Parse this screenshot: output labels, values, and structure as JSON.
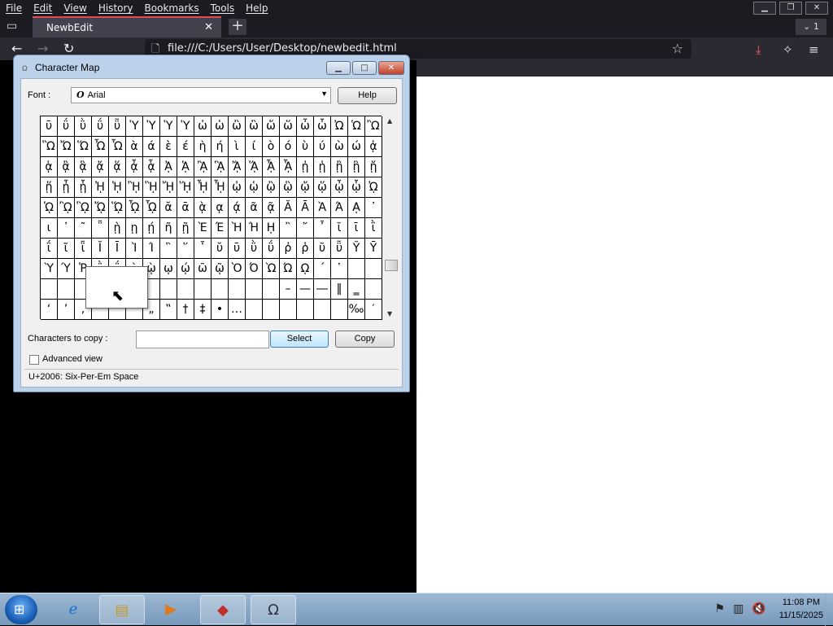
{
  "browser": {
    "menu": [
      "File",
      "Edit",
      "View",
      "History",
      "Bookmarks",
      "Tools",
      "Help"
    ],
    "tab_title": "NewbEdit",
    "tab_count": "1",
    "url": "file:///C:/Users/User/Desktop/newbedit.html"
  },
  "charmap": {
    "title": "Character Map",
    "font_label": "Font :",
    "font_value": "Arial",
    "help_label": "Help",
    "grid": [
      [
        "ῡ",
        "ΰ",
        "ῢ",
        "ΰ",
        "ῧ",
        "Ὑ",
        "Ὑ",
        "Ὑ",
        "Ὑ",
        "ὠ",
        "ὡ",
        "ὢ",
        "ὣ",
        "ὤ",
        "ὥ",
        "ὦ",
        "ὧ",
        "Ὠ",
        "Ὡ",
        "Ὢ"
      ],
      [
        "Ὣ",
        "Ὤ",
        "Ὥ",
        "Ὦ",
        "Ὧ",
        "ὰ",
        "ά",
        "ὲ",
        "έ",
        "ὴ",
        "ή",
        "ὶ",
        "ί",
        "ὸ",
        "ό",
        "ὺ",
        "ύ",
        "ὼ",
        "ώ",
        "ᾀ"
      ],
      [
        "ᾁ",
        "ᾂ",
        "ᾃ",
        "ᾄ",
        "ᾅ",
        "ᾆ",
        "ᾇ",
        "ᾈ",
        "ᾉ",
        "ᾊ",
        "ᾋ",
        "ᾌ",
        "ᾍ",
        "ᾎ",
        "ᾏ",
        "ᾐ",
        "ᾑ",
        "ᾒ",
        "ᾓ",
        "ᾔ"
      ],
      [
        "ᾕ",
        "ᾖ",
        "ᾗ",
        "ᾘ",
        "ᾙ",
        "ᾚ",
        "ᾛ",
        "ᾜ",
        "ᾝ",
        "ᾞ",
        "ᾟ",
        "ᾠ",
        "ᾡ",
        "ᾢ",
        "ᾣ",
        "ᾤ",
        "ᾥ",
        "ᾦ",
        "ᾧ",
        "ᾨ"
      ],
      [
        "ᾩ",
        "ᾪ",
        "ᾫ",
        "ᾬ",
        "ᾭ",
        "ᾮ",
        "ᾯ",
        "ᾰ",
        "ᾱ",
        "ᾲ",
        "ᾳ",
        "ᾴ",
        "ᾶ",
        "ᾷ",
        "Ᾰ",
        "Ᾱ",
        "Ὰ",
        "Ά",
        "ᾼ",
        "᾽"
      ],
      [
        "ι",
        "᾿",
        "῀",
        "῁",
        "ῂ",
        "ῃ",
        "ῄ",
        "ῆ",
        "ῇ",
        "Ὲ",
        "Έ",
        "Ὴ",
        "Ή",
        "ῌ",
        "῍",
        "῎",
        "῏",
        "ῐ",
        "ῑ",
        "ῒ"
      ],
      [
        "ΐ",
        "ῖ",
        "ῗ",
        "Ῐ",
        "Ῑ",
        "Ὶ",
        "Ί",
        "῝",
        "῞",
        "῟",
        "ῠ",
        "ῡ",
        "ῢ",
        "ΰ",
        "ῤ",
        "ῥ",
        "ῦ",
        "ῧ",
        "Ῠ",
        "Ῡ"
      ],
      [
        "Ὺ",
        "Ύ",
        "Ῥ",
        "῭",
        "΅",
        "`",
        "ῲ",
        "ῳ",
        "ῴ",
        "ῶ",
        "ῷ",
        "Ὸ",
        "Ό",
        "Ὼ",
        "Ώ",
        "ῼ",
        "´",
        "῾",
        "",
        ""
      ],
      [
        "",
        "",
        "",
        "",
        "",
        "",
        "",
        "",
        "",
        "",
        "",
        "",
        "",
        "",
        "–",
        "—",
        "―",
        "‖",
        "‗",
        ""
      ],
      [
        "‘",
        "’",
        "‚",
        "‛",
        "“",
        "”",
        "„",
        "‟",
        "†",
        "‡",
        "•",
        "…",
        "",
        "",
        "",
        "",
        "",
        "",
        "‰",
        "′"
      ]
    ],
    "chars_to_copy_label": "Characters to copy :",
    "chars_to_copy_value": "",
    "select_label": "Select",
    "copy_label": "Copy",
    "advanced_label": "Advanced view",
    "status": "U+2006: Six-Per-Em Space"
  },
  "taskbar": {
    "time": "11:08 PM",
    "date": "11/15/2025"
  }
}
